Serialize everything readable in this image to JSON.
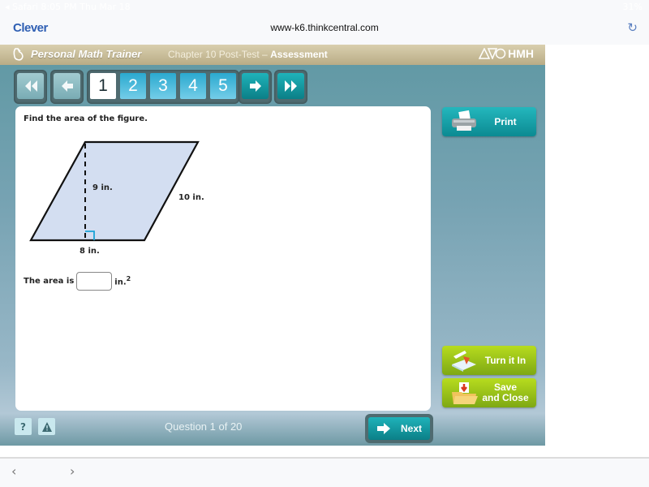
{
  "status_bar": {
    "left_text": "◂ Safari  8:05 PM  Thu Mar 18",
    "right_text": "31%"
  },
  "browser": {
    "back_app_label": "Clever",
    "url": "www-k6.thinkcentral.com",
    "reload_icon": "reload-icon",
    "nav_back_glyph": "‹",
    "nav_forward_glyph": "›"
  },
  "app_header": {
    "brand": "Personal Math Trainer",
    "chapter": "Chapter 10 Post-Test – ",
    "section": "Assessment",
    "publisher": "HMH"
  },
  "navigation": {
    "pages": [
      "1",
      "2",
      "3",
      "4",
      "5"
    ],
    "active_page": "1"
  },
  "question": {
    "prompt": "Find the area of the figure.",
    "height_label": "9 in.",
    "side_label": "10 in.",
    "base_label": "8 in.",
    "answer_prefix": "The area is",
    "answer_value": "",
    "answer_unit": "in.",
    "answer_unit_exp": "2"
  },
  "actions": {
    "print": "Print",
    "turn_in": "Turn it In",
    "save_line1": "Save",
    "save_line2": "and Close"
  },
  "footer": {
    "help_glyph": "?",
    "question_counter": "Question 1 of 20",
    "next": "Next"
  },
  "colors": {
    "teal_button": "#12a0a7",
    "green_button": "#9cc41a",
    "header_tan": "#c9bd98",
    "figure_fill": "#d3def1",
    "right_angle_mark": "#1aa3d6"
  }
}
